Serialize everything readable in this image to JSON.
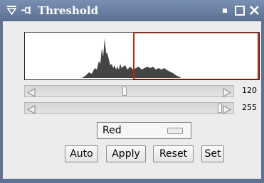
{
  "window": {
    "title": "Threshold"
  },
  "colors": {
    "titlebar": "#5f7494",
    "histogram_fill": "#444444",
    "threshold_overlay": "#cc2200",
    "background": "#ececec"
  },
  "icons": {
    "window_menu": "menu-down-triangle-icon",
    "pin": "pin-icon",
    "minimize": "minimize-icon",
    "maximize": "maximize-icon",
    "close": "close-icon"
  },
  "histogram": {
    "threshold_range": [
      120,
      255
    ]
  },
  "sliders": {
    "lower": {
      "value": "120",
      "fraction": 0.47
    },
    "upper": {
      "value": "255",
      "fraction": 1.0
    }
  },
  "choice": {
    "selected": "Red"
  },
  "buttons": {
    "auto": "Auto",
    "apply": "Apply",
    "reset": "Reset",
    "set": "Set"
  }
}
